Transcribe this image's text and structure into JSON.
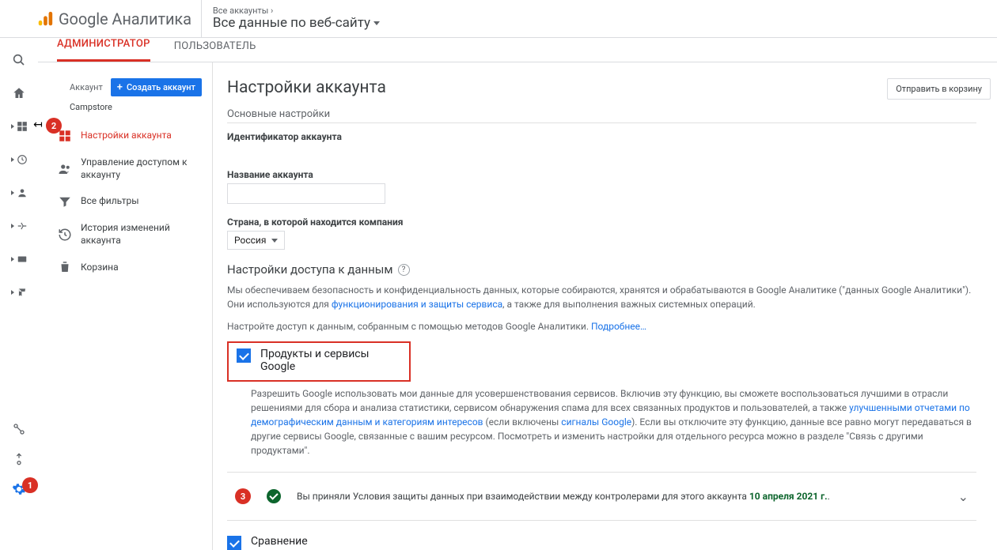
{
  "header": {
    "brand": "Google Аналитика",
    "path": "Все аккаунты ›",
    "view": "Все данные по веб-сайту"
  },
  "tabs": {
    "admin": "АДМИНИСТРАТОР",
    "user": "ПОЛЬЗОВАТЕЛЬ"
  },
  "side": {
    "acct_lbl": "Аккаунт",
    "create": "Создать аккаунт",
    "acct_val": "Campstore",
    "items": [
      "Настройки аккаунта",
      "Управление доступом к аккаунту",
      "Все фильтры",
      "История изменений аккаунта",
      "Корзина"
    ]
  },
  "badges": {
    "b1": "1",
    "b2": "2",
    "b3": "3"
  },
  "panel": {
    "title": "Настройки аккаунта",
    "trash": "Отправить в корзину",
    "sec1": "Основные настройки",
    "id_lbl": "Идентификатор аккаунта",
    "id_val": "",
    "name_lbl": "Название аккаунта",
    "name_val": "",
    "country_lbl": "Страна, в которой находится компания",
    "country_val": "Россия",
    "sec2": "Настройки доступа к данным",
    "p1a": "Мы обеспечиваем безопасность и конфиденциальность данных, которые собираются, хранятся и обрабатываются в Google Аналитике (\"данных Google Аналитики\"). Они используются для ",
    "p1link": "функционирования и защиты сервиса",
    "p1b": ", а также для выполнения важных системных операций.",
    "p2a": "Настройте доступ к данным, собранным с помощью методов Google Аналитики. ",
    "p2link": "Подробнее…",
    "chk1_title": "Продукты и сервисы Google",
    "chk1_a": "Разрешить Google использовать мои данные для усовершенствования сервисов. Включив эту функцию, вы сможете воспользоваться лучшими в отрасли решениями для сбора и анализа статистики, сервисом обнаружения спама для всех связанных продуктов и пользователей, а также ",
    "chk1_l1": "улучшенными отчетами по демографическим данным и категориям интересов",
    "chk1_b": " (если включены ",
    "chk1_l2": "сигналы Google",
    "chk1_c": "). Если вы отключите эту функцию, данные все равно могут передаваться в другие сервисы Google, связанные с вашим ресурсом. Посмотреть и изменить настройки для отдельного ресурса можно в разделе \"Связь с другими продуктами\".",
    "accept": "Вы приняли Условия защиты данных при взаимодействии между контролерами для этого аккаунта ",
    "accept_date": "10 апреля 2021 г.",
    "chk2_title": "Сравнение"
  }
}
